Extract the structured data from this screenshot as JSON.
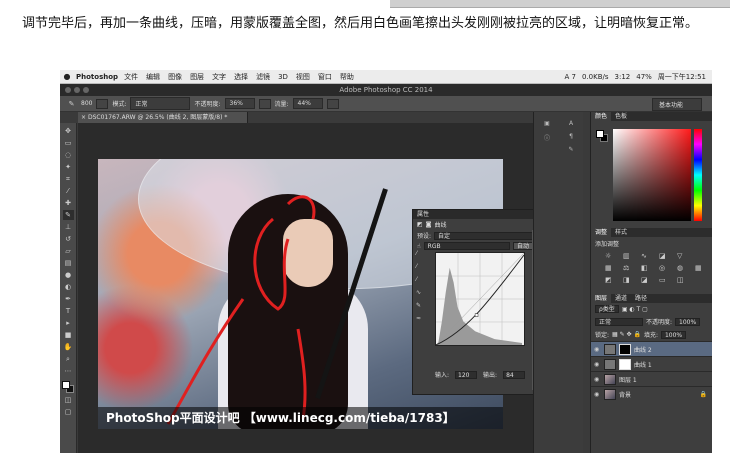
{
  "caption": "调节完毕后，再加一条曲线，压暗，用蒙版覆盖全图，然后用白色画笔擦出头发刚刚被拉亮的区域，让明暗恢复正常。",
  "menubar": {
    "apple": "",
    "app": "Photoshop",
    "items": [
      "文件",
      "编辑",
      "图像",
      "图层",
      "文字",
      "选择",
      "滤镜",
      "3D",
      "视图",
      "窗口",
      "帮助"
    ],
    "status": {
      "ai": "A 7",
      "net": "0.0KB/s",
      "time_batt": "3:12",
      "wifi": "47%",
      "clock": "周一下午12:51"
    }
  },
  "window": {
    "title": "Adobe Photoshop CC 2014"
  },
  "options": {
    "brush_size": "800",
    "mode_label": "模式:",
    "mode_value": "正常",
    "opacity_label": "不透明度:",
    "opacity_value": "36%",
    "flow_label": "流量:",
    "flow_value": "44%",
    "workspace": "基本功能"
  },
  "document": {
    "tab": "DSC01767.ARW @ 26.5% (曲线 2, 图层蒙版/8) *"
  },
  "watermark": "PhotoShop平面设计吧 【www.linecg.com/tieba/1783】",
  "properties": {
    "header": "属性",
    "panel_name": "曲线",
    "preset_label": "预设:",
    "preset_value": "自定",
    "channel": "RGB",
    "auto": "自动",
    "input_label": "输入:",
    "input_value": "120",
    "output_label": "输出:",
    "output_value": "84"
  },
  "color_panel": {
    "tabs": [
      "颜色",
      "色板"
    ]
  },
  "adjust_panel": {
    "tabs": [
      "调整",
      "样式"
    ],
    "label": "添加调整"
  },
  "layers_panel": {
    "tabs": [
      "图层",
      "通道",
      "路径"
    ],
    "kind": "ρ类型",
    "blend": "正常",
    "opacity_label": "不透明度:",
    "opacity": "100%",
    "lock_label": "锁定:",
    "fill_label": "填充:",
    "fill": "100%",
    "layers": [
      {
        "name": "曲线 2"
      },
      {
        "name": "曲线 1"
      },
      {
        "name": "图层 1"
      },
      {
        "name": "背景"
      }
    ]
  }
}
